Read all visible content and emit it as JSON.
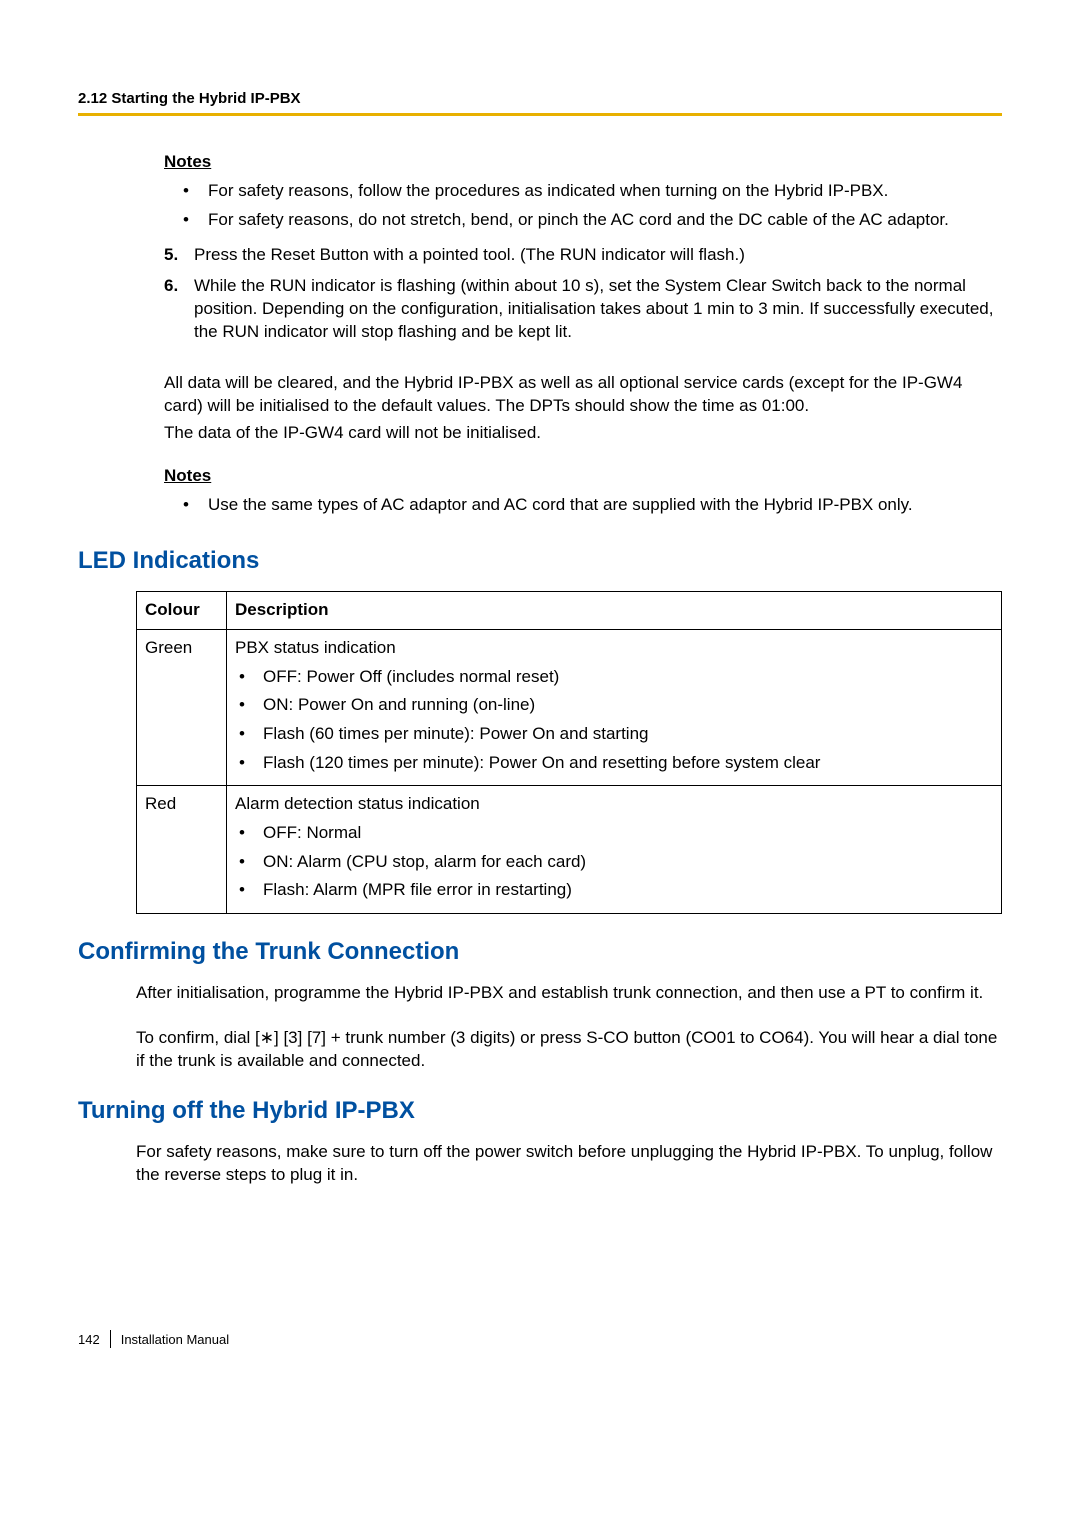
{
  "header": {
    "section_number": "2.12 Starting the Hybrid IP-PBX"
  },
  "notes1": {
    "heading": "Notes",
    "items": [
      "For safety reasons, follow the procedures as indicated when turning on the Hybrid IP-PBX.",
      "For safety reasons, do not stretch, bend, or pinch the AC cord and the DC cable of the AC adaptor."
    ]
  },
  "steps": [
    {
      "num": "5.",
      "text": "Press the Reset Button with a pointed tool. (The RUN indicator will flash.)"
    },
    {
      "num": "6.",
      "text": "While the RUN indicator is flashing (within about 10 s), set the System Clear Switch back to the normal position. Depending on the configuration, initialisation takes about 1 min to 3 min. If successfully executed, the RUN indicator will stop flashing and be kept lit."
    }
  ],
  "para_after_steps": [
    "All data will be cleared, and the Hybrid IP-PBX as well as all optional service cards (except for the IP-GW4 card) will be initialised to the default values. The DPTs should show the time as 01:00.",
    "The data of the IP-GW4 card will not be initialised."
  ],
  "notes2": {
    "heading": "Notes",
    "items": [
      "Use the same types of AC adaptor and AC cord that are supplied with the Hybrid IP-PBX only."
    ]
  },
  "led_section": {
    "heading": "LED Indications",
    "th_colour": "Colour",
    "th_desc": "Description",
    "rows": [
      {
        "colour": "Green",
        "desc_title": "PBX status indication",
        "bullets": [
          "OFF: Power Off (includes normal reset)",
          "ON: Power On and running (on-line)",
          "Flash (60 times per minute): Power On and starting",
          "Flash (120 times per minute): Power On and resetting before system clear"
        ]
      },
      {
        "colour": "Red",
        "desc_title": "Alarm detection status indication",
        "bullets": [
          "OFF: Normal",
          "ON: Alarm (CPU stop, alarm for each card)",
          "Flash: Alarm (MPR file error in restarting)"
        ]
      }
    ]
  },
  "trunk_section": {
    "heading": "Confirming the Trunk Connection",
    "p1": "After initialisation, programme the Hybrid IP-PBX and establish trunk connection, and then use a PT to confirm it.",
    "p2": "To confirm, dial [∗] [3] [7] + trunk number (3 digits) or press S-CO button (CO01 to CO64). You will hear a dial tone if the trunk is available and connected."
  },
  "turnoff_section": {
    "heading": "Turning off the Hybrid IP-PBX",
    "p1": "For safety reasons, make sure to turn off the power switch before unplugging the Hybrid IP-PBX. To unplug, follow the reverse steps to plug it in."
  },
  "footer": {
    "page": "142",
    "manual": "Installation Manual"
  }
}
